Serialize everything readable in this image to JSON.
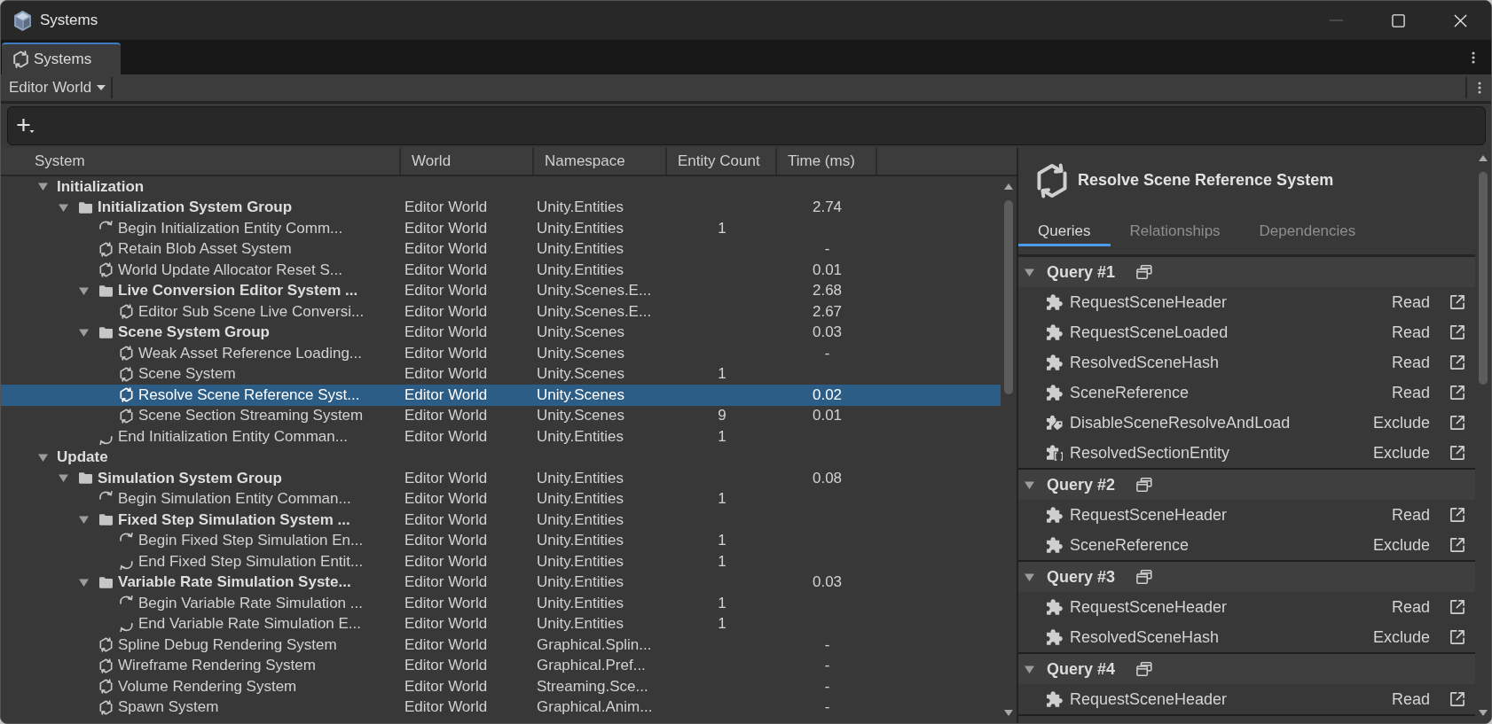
{
  "window": {
    "title": "Systems",
    "minimize_disabled": true
  },
  "tabs": [
    {
      "label": "Systems",
      "selected": true
    }
  ],
  "toolbar": {
    "world_dropdown": "Editor World"
  },
  "tree": {
    "columns": [
      "System",
      "World",
      "Namespace",
      "Entity Count",
      "Time (ms)"
    ],
    "rows": [
      {
        "name": "Initialization",
        "kind": "category",
        "expanded": true,
        "selected": false,
        "children": [
          {
            "name": "Initialization System Group",
            "kind": "group",
            "expanded": true,
            "selected": false,
            "world": "Editor World",
            "namespace": "Unity.Entities",
            "time": "2.74",
            "children": [
              {
                "name": "Begin Initialization Entity Comm...",
                "kind": "begin",
                "selected": false,
                "world": "Editor World",
                "namespace": "Unity.Entities",
                "entity_count": "1"
              },
              {
                "name": "Retain Blob Asset System",
                "kind": "system",
                "selected": false,
                "world": "Editor World",
                "namespace": "Unity.Entities",
                "time": "-"
              },
              {
                "name": "World Update Allocator Reset S...",
                "kind": "system",
                "selected": false,
                "world": "Editor World",
                "namespace": "Unity.Entities",
                "time": "0.01"
              },
              {
                "name": "Live Conversion Editor System ...",
                "kind": "group",
                "expanded": true,
                "selected": false,
                "world": "Editor World",
                "namespace": "Unity.Scenes.E...",
                "time": "2.68",
                "children": [
                  {
                    "name": "Editor Sub Scene Live Conversi...",
                    "kind": "system",
                    "selected": false,
                    "world": "Editor World",
                    "namespace": "Unity.Scenes.E...",
                    "time": "2.67"
                  }
                ]
              },
              {
                "name": "Scene System Group",
                "kind": "group",
                "expanded": true,
                "selected": false,
                "world": "Editor World",
                "namespace": "Unity.Scenes",
                "time": "0.03",
                "children": [
                  {
                    "name": "Weak Asset Reference Loading...",
                    "kind": "system",
                    "selected": false,
                    "world": "Editor World",
                    "namespace": "Unity.Scenes",
                    "time": "-"
                  },
                  {
                    "name": "Scene System",
                    "kind": "system",
                    "selected": false,
                    "world": "Editor World",
                    "namespace": "Unity.Scenes",
                    "entity_count": "1"
                  },
                  {
                    "name": "Resolve Scene Reference Syst...",
                    "kind": "system",
                    "selected": true,
                    "world": "Editor World",
                    "namespace": "Unity.Scenes",
                    "time": "0.02"
                  },
                  {
                    "name": "Scene Section Streaming System",
                    "kind": "system",
                    "selected": false,
                    "world": "Editor World",
                    "namespace": "Unity.Scenes",
                    "entity_count": "9",
                    "time": "0.01"
                  }
                ]
              },
              {
                "name": "End Initialization Entity Comman...",
                "kind": "end",
                "selected": false,
                "world": "Editor World",
                "namespace": "Unity.Entities",
                "entity_count": "1"
              }
            ]
          }
        ]
      },
      {
        "name": "Update",
        "kind": "category",
        "expanded": true,
        "selected": false,
        "children": [
          {
            "name": "Simulation System Group",
            "kind": "group",
            "expanded": true,
            "selected": false,
            "world": "Editor World",
            "namespace": "Unity.Entities",
            "time": "0.08",
            "children": [
              {
                "name": "Begin Simulation Entity Comman...",
                "kind": "begin",
                "selected": false,
                "world": "Editor World",
                "namespace": "Unity.Entities",
                "entity_count": "1"
              },
              {
                "name": "Fixed Step Simulation System ...",
                "kind": "group",
                "expanded": true,
                "selected": false,
                "world": "Editor World",
                "namespace": "Unity.Entities",
                "children": [
                  {
                    "name": "Begin Fixed Step Simulation En...",
                    "kind": "begin",
                    "selected": false,
                    "world": "Editor World",
                    "namespace": "Unity.Entities",
                    "entity_count": "1"
                  },
                  {
                    "name": "End Fixed Step Simulation Entit...",
                    "kind": "end",
                    "selected": false,
                    "world": "Editor World",
                    "namespace": "Unity.Entities",
                    "entity_count": "1"
                  }
                ]
              },
              {
                "name": "Variable Rate Simulation Syste...",
                "kind": "group",
                "expanded": true,
                "selected": false,
                "world": "Editor World",
                "namespace": "Unity.Entities",
                "time": "0.03",
                "children": [
                  {
                    "name": "Begin Variable Rate Simulation ...",
                    "kind": "begin",
                    "selected": false,
                    "world": "Editor World",
                    "namespace": "Unity.Entities",
                    "entity_count": "1"
                  },
                  {
                    "name": "End Variable Rate Simulation E...",
                    "kind": "end",
                    "selected": false,
                    "world": "Editor World",
                    "namespace": "Unity.Entities",
                    "entity_count": "1"
                  }
                ]
              },
              {
                "name": "Spline Debug Rendering System",
                "kind": "system",
                "selected": false,
                "world": "Editor World",
                "namespace": "Graphical.Splin...",
                "time": "-"
              },
              {
                "name": "Wireframe Rendering System",
                "kind": "system",
                "selected": false,
                "world": "Editor World",
                "namespace": "Graphical.Pref...",
                "time": "-"
              },
              {
                "name": "Volume Rendering System",
                "kind": "system",
                "selected": false,
                "world": "Editor World",
                "namespace": "Streaming.Sce...",
                "time": "-"
              },
              {
                "name": "Spawn System",
                "kind": "system",
                "selected": false,
                "world": "Editor World",
                "namespace": "Graphical.Anim...",
                "time": "-"
              }
            ]
          }
        ]
      }
    ]
  },
  "inspector": {
    "title": "Resolve Scene Reference System",
    "tabs": [
      {
        "label": "Queries",
        "selected": true
      },
      {
        "label": "Relationships",
        "selected": false
      },
      {
        "label": "Dependencies",
        "selected": false
      }
    ],
    "queries": [
      {
        "title": "Query #1",
        "expanded": true,
        "components": [
          {
            "name": "RequestSceneHeader",
            "kind": "component",
            "access": "Read"
          },
          {
            "name": "RequestSceneLoaded",
            "kind": "component",
            "access": "Read"
          },
          {
            "name": "ResolvedSceneHash",
            "kind": "component",
            "access": "Read"
          },
          {
            "name": "SceneReference",
            "kind": "component",
            "access": "Read"
          },
          {
            "name": "DisableSceneResolveAndLoad",
            "kind": "tag",
            "access": "Exclude"
          },
          {
            "name": "ResolvedSectionEntity",
            "kind": "buffer",
            "access": "Exclude"
          }
        ]
      },
      {
        "title": "Query #2",
        "expanded": true,
        "components": [
          {
            "name": "RequestSceneHeader",
            "kind": "component",
            "access": "Read"
          },
          {
            "name": "SceneReference",
            "kind": "component",
            "access": "Exclude"
          }
        ]
      },
      {
        "title": "Query #3",
        "expanded": true,
        "components": [
          {
            "name": "RequestSceneHeader",
            "kind": "component",
            "access": "Read"
          },
          {
            "name": "ResolvedSceneHash",
            "kind": "component",
            "access": "Exclude"
          }
        ]
      },
      {
        "title": "Query #4",
        "expanded": true,
        "components": [
          {
            "name": "RequestSceneHeader",
            "kind": "component",
            "access": "Read"
          }
        ]
      }
    ]
  }
}
